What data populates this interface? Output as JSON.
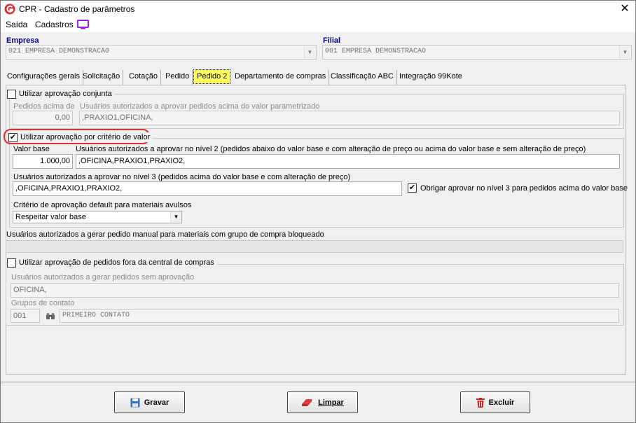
{
  "window": {
    "title": "CPR - Cadastro de parâmetros",
    "close_symbol": "✕"
  },
  "menu": {
    "items": [
      "Saída",
      "Cadastros"
    ]
  },
  "empresa": {
    "label": "Empresa",
    "value": "021 EMPRESA DEMONSTRACAO"
  },
  "filial": {
    "label": "Filial",
    "value": "001 EMPRESA DEMONSTRACAO"
  },
  "tabs": [
    "Configurações gerais",
    "Solicitação",
    "Cotação",
    "Pedido",
    "Pedido 2",
    "Departamento de compras",
    "Classificação ABC",
    "Integração 99Kote"
  ],
  "active_tab": "Pedido 2",
  "aprovacao_conjunta": {
    "checkbox_label": "Utilizar aprovação conjunta",
    "checked": false,
    "pedidos_label": "Pedidos acima de",
    "pedidos_value": "0,00",
    "usuarios_label": "Usuários autorizados a aprovar pedidos acima do valor parametrizado",
    "usuarios_value": ",PRAXIO1,OFICINA,"
  },
  "aprovacao_criterio": {
    "checkbox_label": "Utilizar aprovação por critério de valor",
    "checked": true,
    "valor_base_label": "Valor base",
    "valor_base_value": "1.000,00",
    "nivel2_label": "Usuários autorizados a aprovar no nível 2 (pedidos abaixo do valor base e com alteração de preço ou acima do valor base e sem alteração de preço)",
    "nivel2_value": ",OFICINA,PRAXIO1,PRAXIO2,",
    "nivel3_label": "Usuários autorizados a aprovar no nível 3 (pedidos acima do valor base e com alteração de preço)",
    "nivel3_value": ",OFICINA,PRAXIO1,PRAXIO2,",
    "obrigar_label": "Obrigar aprovar no nível 3 para pedidos acima do valor base",
    "obrigar_checked": true,
    "criterio_label": "Critério de aprovação default para materiais avulsos",
    "criterio_value": "Respeitar valor base"
  },
  "pedido_manual": {
    "label": "Usuários autorizados a gerar pedido manual para materiais com grupo de compra bloqueado",
    "value": ""
  },
  "fora_central": {
    "checkbox_label": "Utilizar aprovação de pedidos fora da central de compras",
    "checked": false,
    "usuarios_label": "Usuários autorizados a gerar pedidos sem aprovação",
    "usuarios_value": "OFICINA,",
    "grupos_label": "Grupos de contato",
    "grupo_code": "001",
    "grupo_name": "PRIMEIRO CONTATO"
  },
  "buttons": {
    "gravar": "Gravar",
    "limpar": "Limpar",
    "excluir": "Excluir"
  },
  "colors": {
    "logo": "#e0262a",
    "monitor_icon": "#a020f0",
    "highlight": "#e03030",
    "active_tab": "#ffff60",
    "header_label": "#000080"
  }
}
